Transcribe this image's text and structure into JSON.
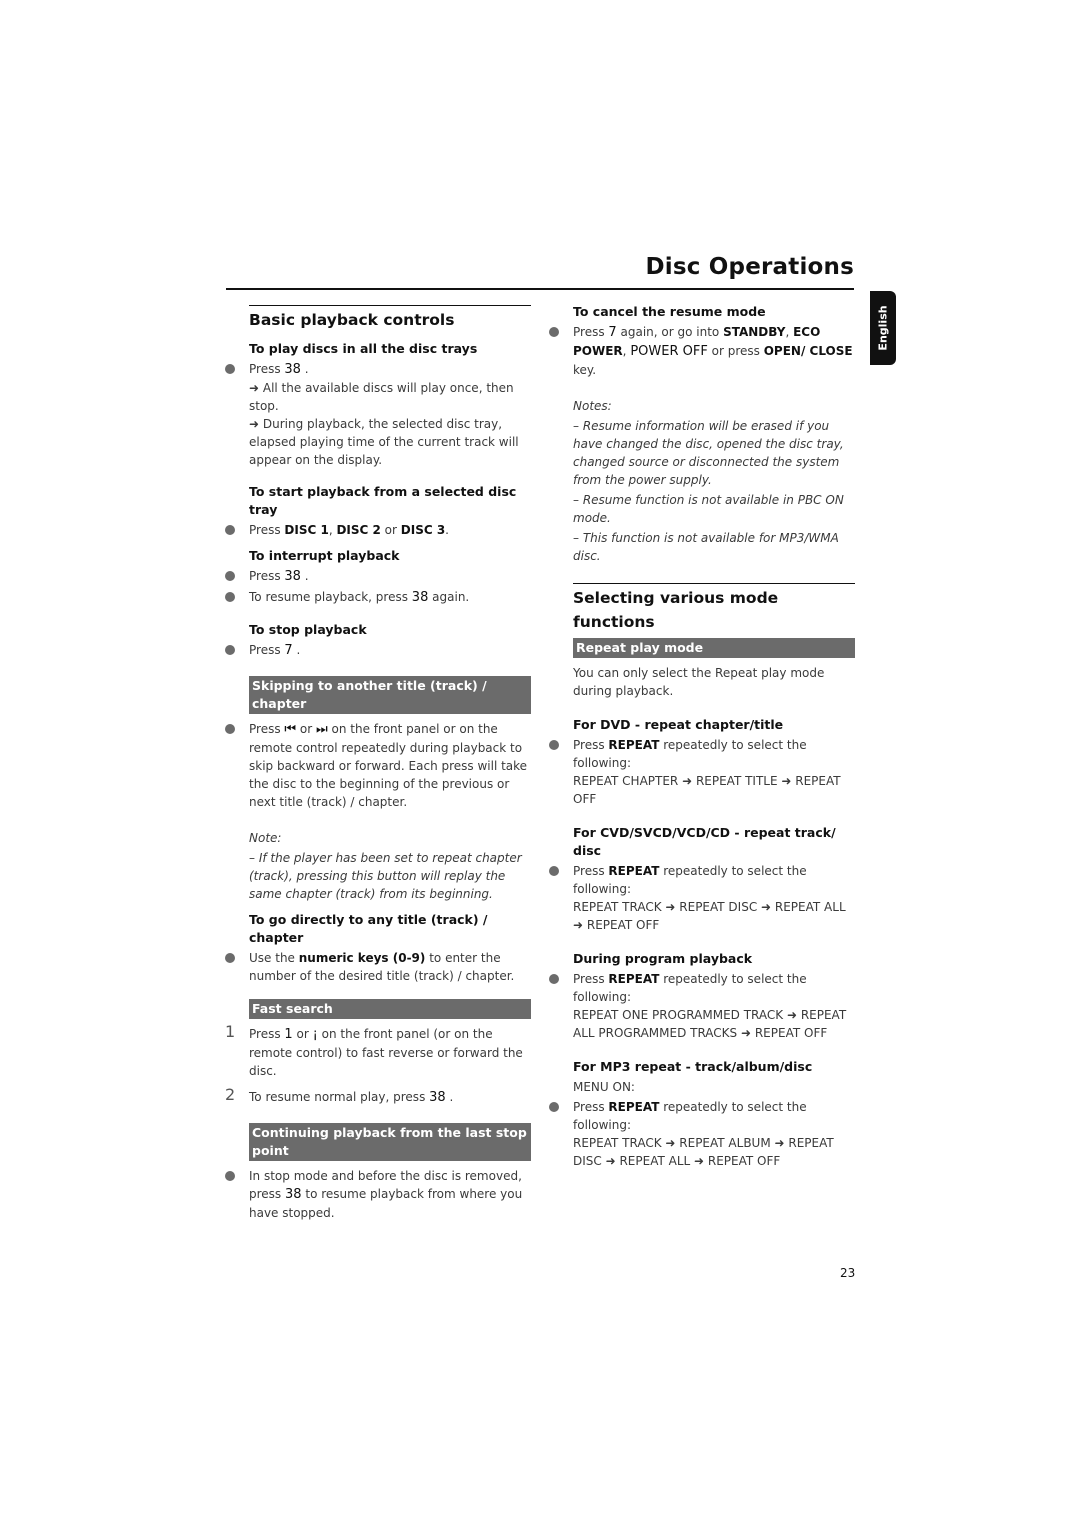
{
  "page": {
    "title": "Disc Operations",
    "language_tab": "English",
    "page_number": "23"
  },
  "left": {
    "section_title": "Basic playback controls",
    "play_all": {
      "heading": "To play discs in all the disc trays",
      "press_prefix": "Press ",
      "press_key": "38",
      "press_suffix": " .",
      "result1": "➜ All the available discs will play once, then stop.",
      "result2": "➜ During playback, the selected disc tray, elapsed playing time of the current track will appear on the display."
    },
    "start_selected": {
      "heading": "To start playback from a selected disc tray",
      "prefix": "Press ",
      "disc1": "DISC 1",
      "sep1": ", ",
      "disc2": "DISC 2",
      "sep2": " or ",
      "disc3": "DISC 3",
      "suffix": "."
    },
    "interrupt": {
      "heading": "To interrupt playback",
      "item1_prefix": "Press ",
      "item1_key": "38",
      "item1_suffix": " .",
      "item2_prefix": "To resume playback, press ",
      "item2_key": "38",
      "item2_suffix": "  again."
    },
    "stop": {
      "heading": "To stop playback",
      "prefix": "Press ",
      "key": "7",
      "suffix": " ."
    },
    "skipping": {
      "bar": "Skipping to another title (track) / chapter",
      "prefix": "Press ",
      "prev_icon": "⏮",
      "mid": " or ",
      "next_icon": "⏭",
      "text": " on the front panel or on the remote control repeatedly during playback to skip backward or forward. Each press will take the disc to the beginning of the previous or next title (track) / chapter.",
      "note_label": "Note:",
      "note_text": "–  If the player has been set to repeat chapter (track), pressing this button will replay the same chapter (track) from its beginning."
    },
    "direct": {
      "heading": "To go directly to any title (track) / chapter",
      "prefix": "Use the ",
      "keys": "numeric keys (0-9)",
      "suffix": " to enter the number of the desired title (track)  / chapter."
    },
    "fast_search": {
      "bar": "Fast search",
      "step1_num": "1",
      "step1_prefix": "Press ",
      "step1_key1": "1",
      "step1_mid": "    or ",
      "step1_key2": "¡",
      "step1_suffix": "     on the front panel (or on the remote control) to fast reverse or forward the disc.",
      "step2_num": "2",
      "step2_prefix": "To resume normal play, press ",
      "step2_key": "38",
      "step2_suffix": " ."
    },
    "continuing": {
      "bar": "Continuing playback from the last stop point",
      "prefix": "In stop mode and before the disc is removed, press ",
      "key": "38",
      "suffix": "  to resume playback from where you have stopped."
    }
  },
  "right": {
    "cancel_resume": {
      "heading": "To cancel the resume mode",
      "prefix": "Press ",
      "key": "7",
      "mid1": "  again, or go into ",
      "standby": "STANDBY",
      "sep": ", ",
      "eco_power": "ECO POWER",
      "sep2": ", ",
      "power_off": "POWER OFF",
      "mid2": "  or press ",
      "open_close": "OPEN/ CLOSE",
      "suffix": " key.",
      "notes_label": "Notes:",
      "note1": "–  Resume information will be erased if you have changed the disc, opened the disc tray, changed source or disconnected the system from the power supply.",
      "note2": "–  Resume function is not available in PBC ON mode.",
      "note3": "–  This function is not available for MP3/WMA disc."
    },
    "section_title": "Selecting various mode functions",
    "repeat": {
      "bar": "Repeat play mode",
      "intro": "You can only select the Repeat play mode during playback.",
      "dvd_heading": "For DVD - repeat chapter/title",
      "press_prefix": "Press ",
      "repeat_key": "REPEAT",
      "press_suffix": " repeatedly to select the following:",
      "dvd_sequence": "REPEAT CHAPTER ➜ REPEAT TITLE ➜ REPEAT OFF",
      "cd_heading": "For CVD/SVCD/VCD/CD - repeat track/ disc",
      "cd_sequence": "REPEAT TRACK ➜ REPEAT DISC ➜ REPEAT ALL ➜ REPEAT OFF",
      "program_heading": "During program playback",
      "program_sequence": "REPEAT ONE PROGRAMMED TRACK ➜ REPEAT ALL PROGRAMMED TRACKS ➜ REPEAT OFF",
      "mp3_heading": "For MP3 repeat - track/album/disc",
      "mp3_menu": "MENU ON:",
      "mp3_sequence": "REPEAT TRACK ➜ REPEAT ALBUM ➜ REPEAT DISC ➜ REPEAT ALL ➜ REPEAT OFF"
    }
  },
  "colors": {
    "bar_bg": "#6b6b6b",
    "bullet": "#6b6b6b",
    "heading": "#111111",
    "body_text": "#3a3a3a"
  }
}
